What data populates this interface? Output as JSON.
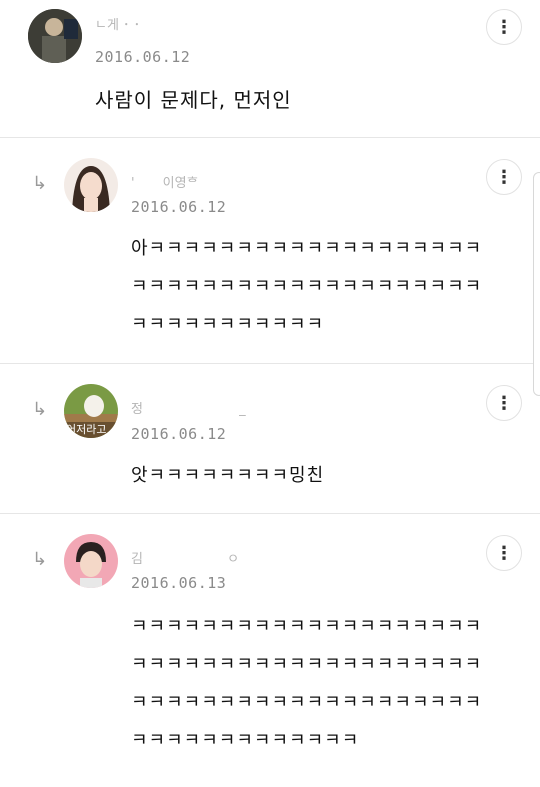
{
  "comments": [
    {
      "author": "ㄴ게 ･ ･",
      "date": "2016.06.12",
      "text": "사람이 문제다, 먼저인",
      "more_icon": "⋮",
      "avatar_colors": [
        "#3a3a3a",
        "#6b6b5c"
      ]
    },
    {
      "reply_icon": "↳",
      "author": "'ᅟ ᅟ이영ᄒ",
      "date": "2016.06.12",
      "text": "아ㅋㅋㅋㅋㅋㅋㅋㅋㅋㅋㅋㅋㅋㅋㅋㅋㅋㅋㅋㅋㅋㅋㅋㅋㅋㅋㅋㅋㅋㅋㅋㅋㅋㅋㅋㅋㅋㅋㅋㅋㅋㅋㅋㅋㅋㅋㅋㅋㅋㅋ",
      "more_icon": "⋮",
      "avatar_colors": [
        "#f1e6df",
        "#3b2a22"
      ]
    },
    {
      "reply_icon": "↳",
      "author": "정ᅟᅟ ᅟᅟ ᅟᅟ ᅟ_",
      "date": "2016.06.12",
      "text": "앗ㅋㅋㅋㅋㅋㅋㅋㅋ밍친",
      "avatar_label": "어저라고",
      "more_icon": "⋮",
      "avatar_colors": [
        "#6b8a3a",
        "#c9a06a"
      ]
    },
    {
      "reply_icon": "↳",
      "author": "김ᅟᅟ ᅟᅟ ᅟᅟ ㅇ",
      "date": "2016.06.13",
      "text": "ㅋㅋㅋㅋㅋㅋㅋㅋㅋㅋㅋㅋㅋㅋㅋㅋㅋㅋㅋㅋㅋㅋㅋㅋㅋㅋㅋㅋㅋㅋㅋㅋㅋㅋㅋㅋㅋㅋㅋㅋㅋㅋㅋㅋㅋㅋㅋㅋㅋㅋㅋㅋㅋㅋㅋㅋㅋㅋㅋㅋㅋㅋㅋㅋㅋㅋㅋㅋㅋㅋㅋㅋㅋ",
      "more_icon": "⋮",
      "avatar_colors": [
        "#f2a7b5",
        "#2a2020"
      ]
    }
  ]
}
